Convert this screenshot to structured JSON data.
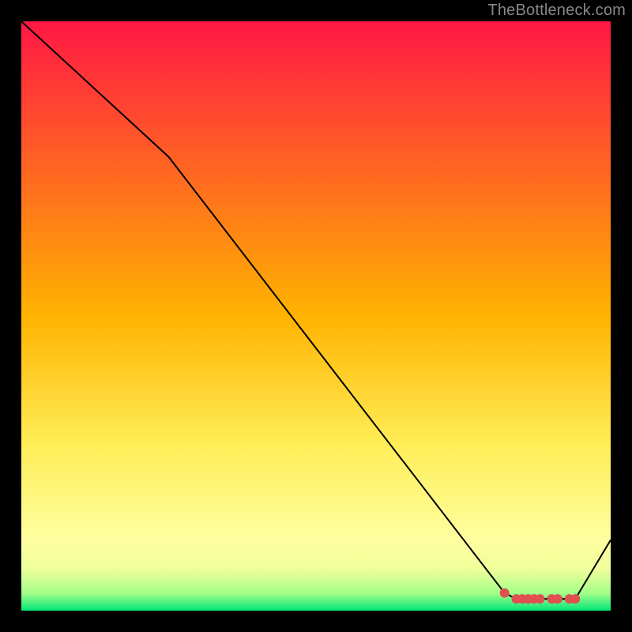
{
  "attribution": "TheBottleneck.com",
  "chart_data": {
    "type": "line",
    "title": "",
    "xlabel": "",
    "ylabel": "",
    "xlim": [
      0,
      100
    ],
    "ylim": [
      0,
      100
    ],
    "grid": false,
    "legend": false,
    "line": {
      "color": "#000000",
      "width": 2,
      "x": [
        0,
        25,
        82,
        84,
        86,
        88,
        90,
        92,
        94,
        100
      ],
      "y": [
        100,
        77,
        3,
        2,
        2,
        2,
        2,
        2,
        2,
        12
      ]
    },
    "markers": {
      "color": "#e05050",
      "size": 6,
      "x": [
        82,
        84,
        85,
        86,
        87,
        88,
        90,
        91,
        93,
        94
      ],
      "y": [
        3,
        2,
        2,
        2,
        2,
        2,
        2,
        2,
        2,
        2
      ]
    },
    "background_gradient": {
      "stops": [
        {
          "offset": 0.0,
          "color": "#ff1744"
        },
        {
          "offset": 0.5,
          "color": "#ffb300"
        },
        {
          "offset": 0.72,
          "color": "#ffee58"
        },
        {
          "offset": 0.88,
          "color": "#ffffa0"
        },
        {
          "offset": 0.93,
          "color": "#eeff9a"
        },
        {
          "offset": 0.97,
          "color": "#a5ff8a"
        },
        {
          "offset": 1.0,
          "color": "#00e676"
        }
      ]
    }
  }
}
